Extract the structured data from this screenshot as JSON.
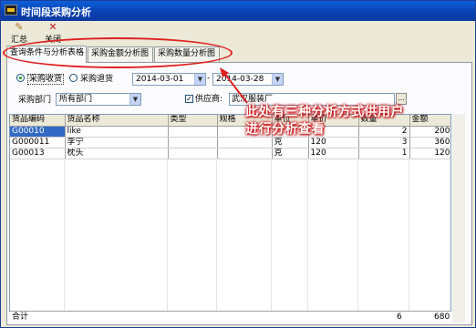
{
  "window": {
    "title": "时间段采购分析"
  },
  "toolbar": {
    "summary_label": "汇总",
    "close_label": "关闭"
  },
  "tabs": [
    {
      "label": "查询条件与分析表格"
    },
    {
      "label": "采购金额分析图"
    },
    {
      "label": "采购数量分析图"
    }
  ],
  "filters": {
    "radio_receive": "采购收货",
    "radio_return": "采购退货",
    "date_from": "2014-03-01",
    "date_sep": "-",
    "date_to": "2014-03-28",
    "dept_label": "采购部门",
    "dept_value": "所有部门",
    "supplier_label": "供应商:",
    "supplier_value": "武汉服装厂",
    "browse_label": "..."
  },
  "table": {
    "columns": [
      "货品编码",
      "货品名称",
      "类型",
      "规格",
      "单位",
      "单价",
      "数量",
      "金额"
    ],
    "rows": [
      [
        "G00010",
        "like",
        "",
        "",
        "",
        "",
        "2",
        "200"
      ],
      [
        "G000011",
        "李宁",
        "",
        "",
        "克",
        "120",
        "3",
        "360"
      ],
      [
        "G00013",
        "枕头",
        "",
        "",
        "克",
        "120",
        "1",
        "120"
      ]
    ],
    "footer": {
      "label": "合计",
      "qty": "6",
      "amount": "680"
    }
  },
  "annotation": {
    "line1": "此处有三种分析方式供用户",
    "line2": "进行分析查看",
    "color": "#e02020"
  }
}
